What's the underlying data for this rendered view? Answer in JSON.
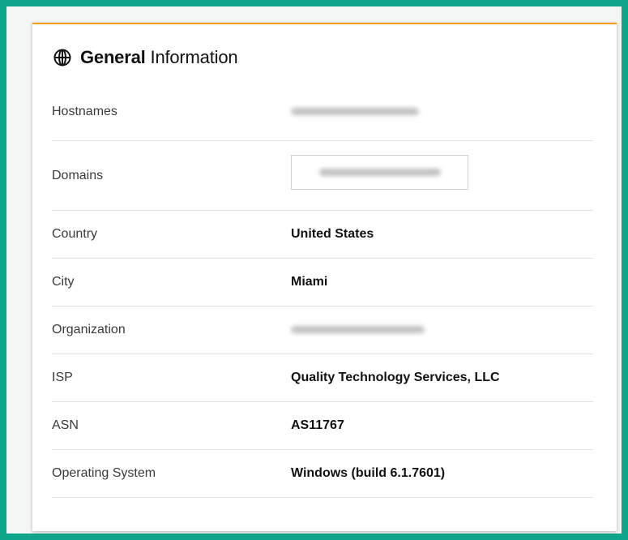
{
  "card": {
    "title_strong": "General",
    "title_rest": "Information",
    "icon": "globe-icon"
  },
  "rows": [
    {
      "label": "Hostnames",
      "value": "",
      "redacted": true
    },
    {
      "label": "Domains",
      "value": "",
      "redacted": true
    },
    {
      "label": "Country",
      "value": "United States"
    },
    {
      "label": "City",
      "value": "Miami"
    },
    {
      "label": "Organization",
      "value": "",
      "redacted": true
    },
    {
      "label": "ISP",
      "value": "Quality Technology Services, LLC"
    },
    {
      "label": "ASN",
      "value": "AS11767"
    },
    {
      "label": "Operating System",
      "value": "Windows (build 6.1.7601)"
    }
  ],
  "colors": {
    "frame": "#0fa58a",
    "card_accent": "#f0a01e"
  }
}
